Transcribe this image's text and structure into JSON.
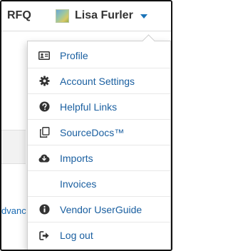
{
  "header": {
    "rfq_label": "RFQ",
    "user_name": "Lisa Furler"
  },
  "background": {
    "partial_link": "dvanc"
  },
  "menu": {
    "items": [
      {
        "label": "Profile",
        "icon": "id-card-icon"
      },
      {
        "label": "Account Settings",
        "icon": "gear-icon"
      },
      {
        "label": "Helpful Links",
        "icon": "question-circle-icon"
      },
      {
        "label": "SourceDocs™",
        "icon": "copy-icon"
      },
      {
        "label": "Imports",
        "icon": "cloud-download-icon"
      },
      {
        "label": "Invoices",
        "icon": ""
      },
      {
        "label": "Vendor UserGuide",
        "icon": "info-circle-icon"
      },
      {
        "label": "Log out",
        "icon": "sign-out-icon"
      }
    ]
  },
  "colors": {
    "link": "#1a5fa0",
    "caret": "#1a73b8",
    "icon": "#333333"
  }
}
